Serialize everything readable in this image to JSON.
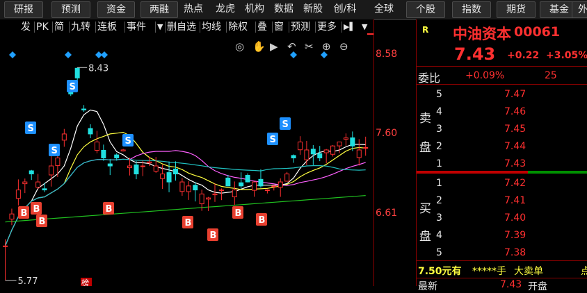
{
  "topbar": {
    "items": [
      {
        "label": "研报",
        "button": true
      },
      {
        "label": "预测",
        "button": true
      },
      {
        "label": "资金",
        "button": true
      },
      {
        "label": "两融",
        "button": true
      },
      {
        "label": "热点",
        "button": false
      },
      {
        "label": "龙虎",
        "button": false
      },
      {
        "label": "机构",
        "button": false
      },
      {
        "label": "数据",
        "button": false
      },
      {
        "label": "新股",
        "button": false
      },
      {
        "label": "创/科",
        "button": false
      },
      {
        "label": "全球",
        "button": false
      },
      {
        "label": "个股",
        "button": true
      },
      {
        "label": "指数",
        "button": true
      },
      {
        "label": "期货",
        "button": true
      },
      {
        "label": "基金",
        "button": true
      },
      {
        "label": "外",
        "button": true
      }
    ]
  },
  "chartbar": {
    "items": [
      "发",
      "PK",
      "简",
      "九转",
      "连板",
      "事件",
      "▼",
      "删自选",
      "均线",
      "除权",
      "叠",
      "窗",
      "预测",
      "更多",
      "▶▌",
      "▼"
    ]
  },
  "chart_tools": [
    "eye-icon",
    "hand-icon",
    "play-icon",
    "undo-icon",
    "scissors-icon",
    "add-icon",
    "remove-icon"
  ],
  "chart": {
    "high_label": "8.43",
    "low_label": "5.77",
    "markers_s_label": "S",
    "markers_b_label": "B",
    "bottom_flag": "榜"
  },
  "axis": {
    "ticks": [
      "8.58",
      "7.60",
      "6.61"
    ]
  },
  "quote": {
    "flag": "R",
    "name": "中油资本",
    "code": "00061",
    "price": "7.43",
    "change": "+0.22",
    "change_pct": "+3.05%",
    "webi_label": "委比",
    "webi_value": "+0.09%",
    "webi_diff": "25",
    "sell_label_1": "卖",
    "sell_label_2": "盘",
    "buy_label_1": "买",
    "buy_label_2": "盘",
    "sell": [
      {
        "level": "5",
        "price": "7.47"
      },
      {
        "level": "4",
        "price": "7.46"
      },
      {
        "level": "3",
        "price": "7.45"
      },
      {
        "level": "2",
        "price": "7.44"
      },
      {
        "level": "1",
        "price": "7.43"
      }
    ],
    "buy": [
      {
        "level": "1",
        "price": "7.42"
      },
      {
        "level": "2",
        "price": "7.41"
      },
      {
        "level": "3",
        "price": "7.40"
      },
      {
        "level": "4",
        "price": "7.39"
      },
      {
        "level": "5",
        "price": "7.38"
      }
    ],
    "bottom_text_1": "7.50元有",
    "bottom_text_2": "*****手",
    "bottom_text_3": "大卖单",
    "bottom_text_4": "点",
    "last_row_1": "最新",
    "last_row_2": "7.43",
    "last_row_3": "开盘"
  },
  "colors": {
    "up": "#ff3030",
    "down": "#20e0e0",
    "ma1": "#ffffff",
    "ma2": "#ffff40",
    "ma3": "#ff60ff",
    "ma4": "#20c0c0",
    "ma5": "#20c020"
  }
}
